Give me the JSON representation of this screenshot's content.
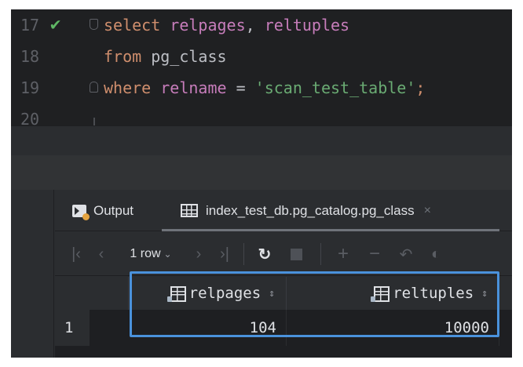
{
  "editor": {
    "lines": [
      {
        "number": "17",
        "parts": [
          {
            "text": "select ",
            "cls": "kw"
          },
          {
            "text": "relpages",
            "cls": "id"
          },
          {
            "text": ", ",
            "cls": "plain"
          },
          {
            "text": "reltuples",
            "cls": "id"
          }
        ]
      },
      {
        "number": "18",
        "parts": [
          {
            "text": "from ",
            "cls": "kw"
          },
          {
            "text": "pg_class",
            "cls": "plain"
          }
        ]
      },
      {
        "number": "19",
        "parts": [
          {
            "text": "where ",
            "cls": "kw"
          },
          {
            "text": "relname",
            "cls": "id"
          },
          {
            "text": " = ",
            "cls": "plain"
          },
          {
            "text": "'scan_test_table'",
            "cls": "str"
          },
          {
            "text": ";",
            "cls": "kw"
          }
        ]
      },
      {
        "number": "20",
        "parts": []
      }
    ],
    "run_status_icon": "checkmark-icon"
  },
  "tabs": {
    "output_label": "Output",
    "table_label": "index_test_db.pg_catalog.pg_class",
    "close_glyph": "×"
  },
  "toolbar": {
    "first_glyph": "|‹",
    "prev_glyph": "‹",
    "rows_label": "1 row",
    "rows_chevron": "⌄",
    "next_glyph": "›",
    "last_glyph": "›|",
    "refresh_glyph": "↻",
    "add_glyph": "+",
    "remove_glyph": "−",
    "revert_glyph": "↶",
    "preview_glyph": "◐"
  },
  "grid": {
    "columns": [
      {
        "name": "relpages"
      },
      {
        "name": "reltuples"
      }
    ],
    "sort_glyph": "⇕",
    "rows": [
      {
        "index": "1",
        "cells": [
          "104",
          "10000"
        ]
      }
    ]
  },
  "colors": {
    "selection_border": "#4a92dc",
    "keyword": "#cf8e6d",
    "identifier": "#c77dbb",
    "string": "#6aab73",
    "success": "#5fb865"
  }
}
